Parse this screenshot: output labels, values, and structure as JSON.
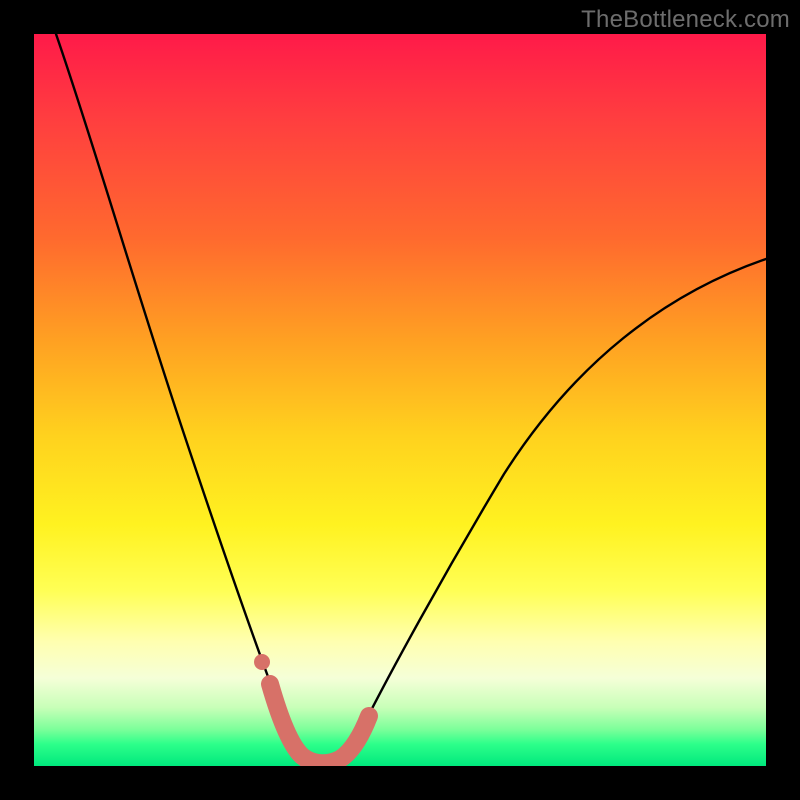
{
  "watermark": "TheBottleneck.com",
  "chart_data": {
    "type": "line",
    "title": "",
    "xlabel": "",
    "ylabel": "",
    "xlim": [
      0,
      100
    ],
    "ylim": [
      0,
      100
    ],
    "series": [
      {
        "name": "bottleneck-curve",
        "x": [
          3,
          6,
          10,
          14,
          18,
          22,
          25,
          27,
          29,
          31,
          33,
          34.5,
          36,
          37,
          38,
          39,
          40,
          41,
          42,
          43,
          45,
          48,
          52,
          56,
          62,
          70,
          80,
          90,
          100
        ],
        "y": [
          100,
          90,
          77,
          64,
          51,
          39,
          29,
          23,
          17,
          12,
          8,
          5,
          3,
          1.5,
          0.8,
          0.5,
          0.5,
          0.8,
          1.5,
          3,
          6,
          11,
          18,
          25,
          34,
          44,
          54,
          62,
          69
        ]
      },
      {
        "name": "highlight-segment",
        "x": [
          32,
          33,
          34,
          35,
          36,
          37,
          38,
          39,
          40,
          41,
          42,
          43,
          44
        ],
        "y": [
          11,
          8,
          5,
          3,
          1.5,
          0.8,
          0.5,
          0.5,
          0.8,
          1.5,
          3,
          4.5,
          7
        ]
      }
    ],
    "colors": {
      "curve": "#000000",
      "highlight": "#d77168",
      "gradient_top": "#ff1a49",
      "gradient_bottom": "#00e87d"
    }
  }
}
